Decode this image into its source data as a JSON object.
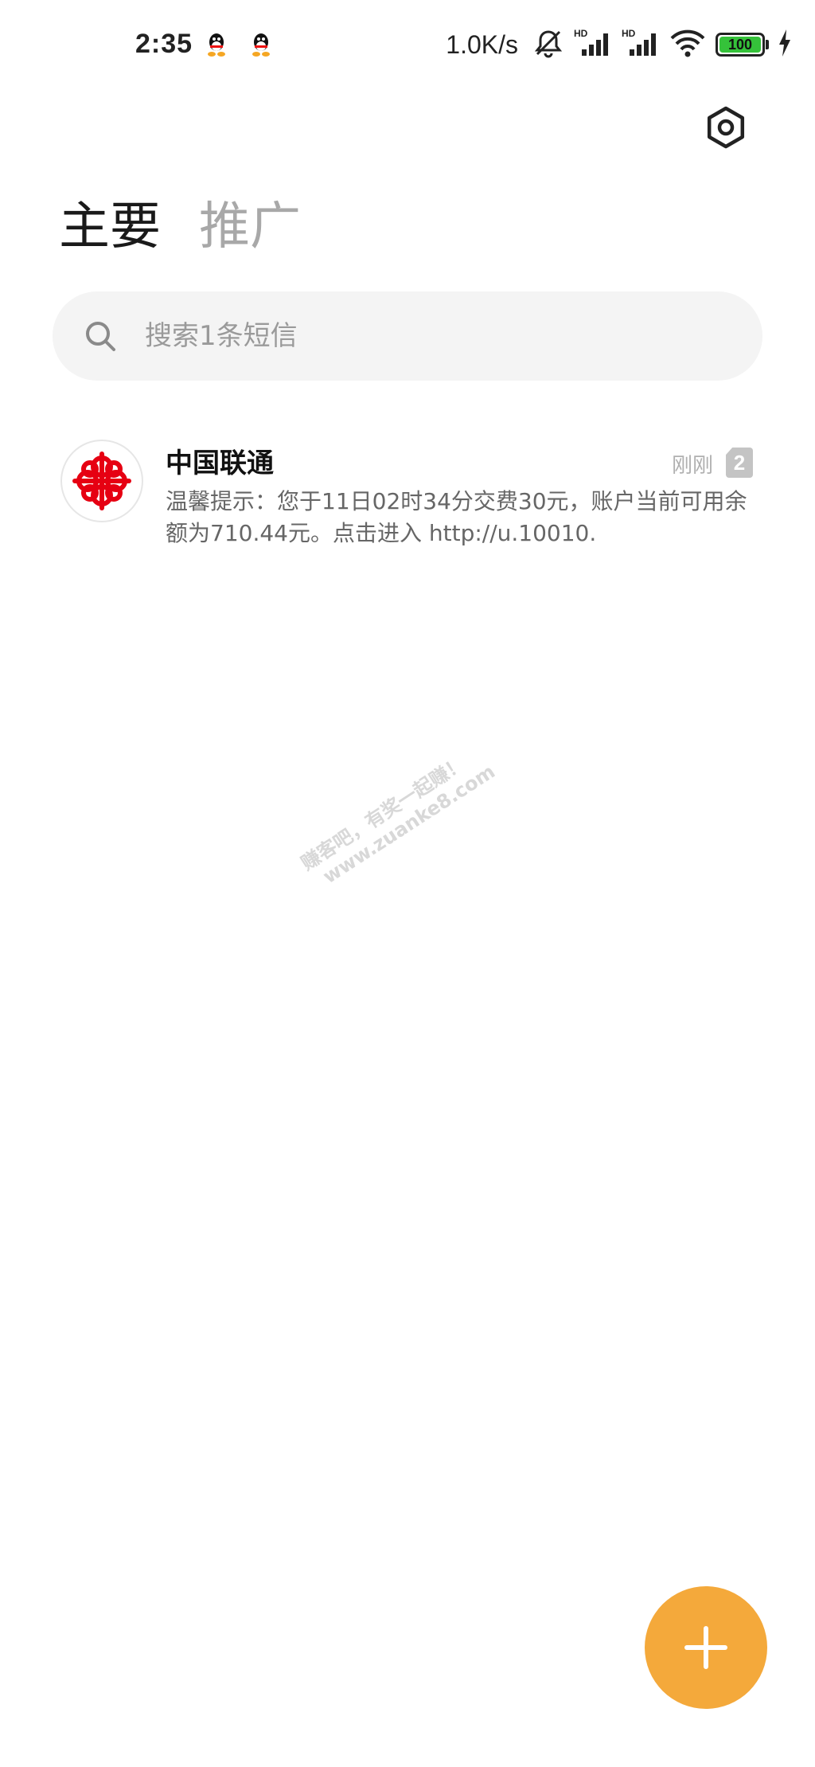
{
  "status_bar": {
    "time": "2:35",
    "net_speed": "1.0K/s",
    "battery_level": "100",
    "battery_fraction": 1.0,
    "icons": [
      "qq-icon",
      "qq-icon",
      "mute-bell-icon",
      "hd-signal-icon",
      "hd-signal-icon",
      "wifi-icon",
      "battery-icon",
      "charging-icon"
    ]
  },
  "header": {
    "settings_icon": "settings-icon"
  },
  "tabs": [
    {
      "label": "主要",
      "active": true
    },
    {
      "label": "推广",
      "active": false
    }
  ],
  "search": {
    "placeholder": "搜索1条短信",
    "value": ""
  },
  "conversations": [
    {
      "sender": "中国联通",
      "time": "刚刚",
      "sim": "2",
      "preview": "温馨提示：您于11日02时34分交费30元，账户当前可用余额为710.44元。点击进入 http://u.10010."
    }
  ],
  "watermark": {
    "line1": "赚客吧，有奖一起赚！",
    "line2": "www.zuanke8.com"
  },
  "fab": {
    "icon": "plus-icon"
  },
  "colors": {
    "accent": "#f4a93b",
    "tab_inactive": "#a8a8a8",
    "search_bg": "#f4f4f4",
    "unicom_red": "#e60012",
    "battery_green": "#35c23a"
  }
}
